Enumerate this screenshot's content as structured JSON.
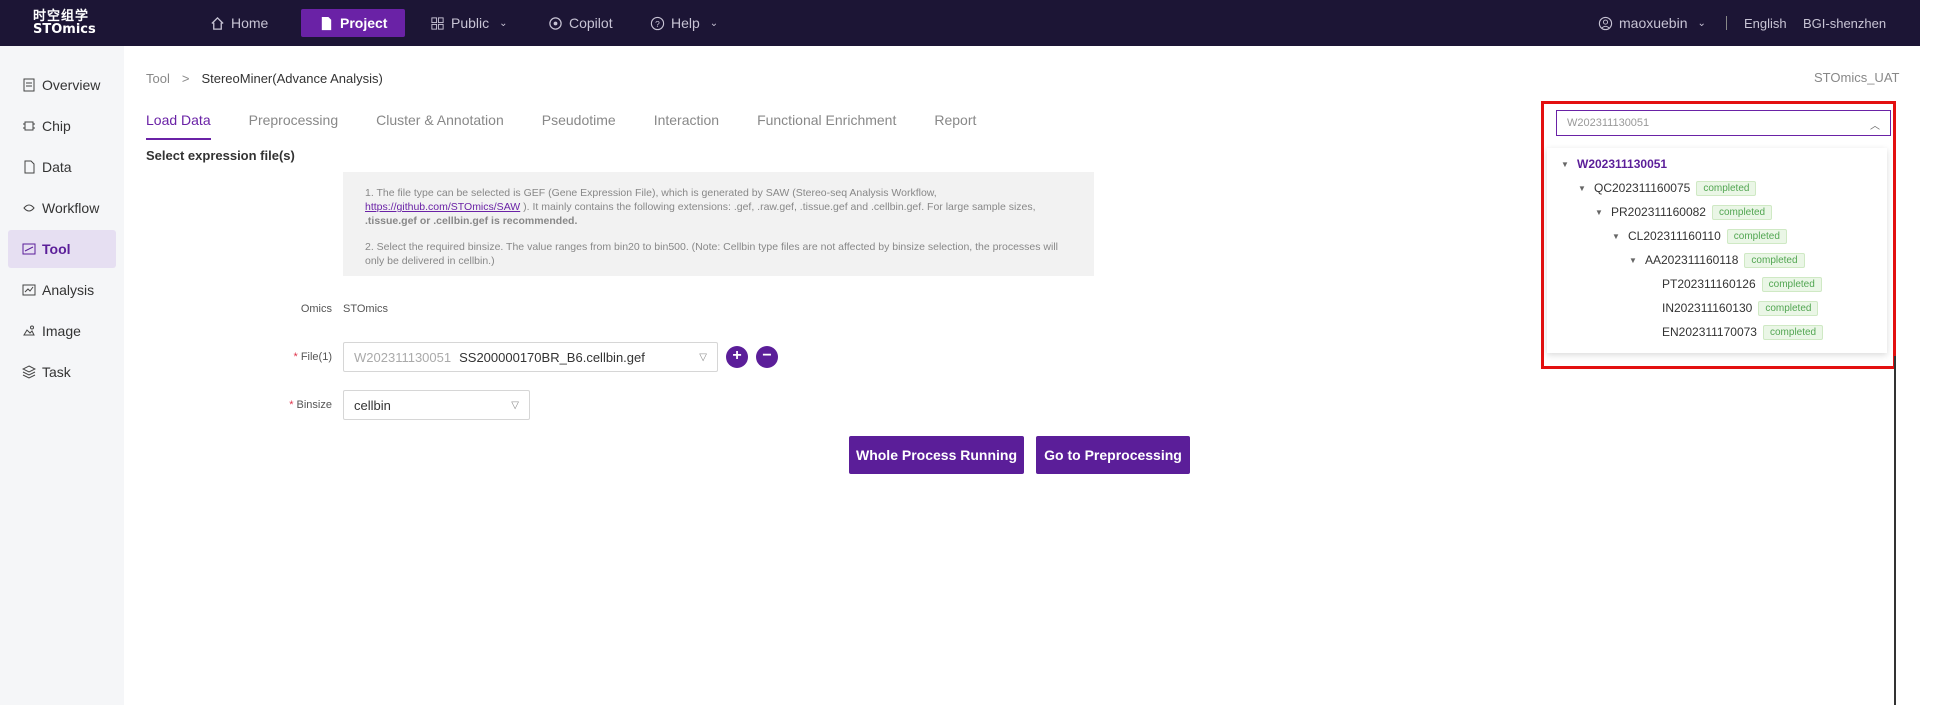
{
  "topbar": {
    "logo_cn": "时空组学",
    "logo_en": "STOmics",
    "nav": [
      {
        "label": "Home",
        "icon": "home-icon"
      },
      {
        "label": "Project",
        "icon": "document-icon"
      },
      {
        "label": "Public",
        "icon": "grid-icon"
      },
      {
        "label": "Copilot",
        "icon": "copilot-icon"
      },
      {
        "label": "Help",
        "icon": "help-icon"
      }
    ],
    "user": "maoxuebin",
    "language": "English",
    "region": "BGI-shenzhen"
  },
  "sidebar": {
    "items": [
      {
        "label": "Overview",
        "icon": "overview-icon"
      },
      {
        "label": "Chip",
        "icon": "chip-icon"
      },
      {
        "label": "Data",
        "icon": "data-icon"
      },
      {
        "label": "Workflow",
        "icon": "workflow-icon"
      },
      {
        "label": "Tool",
        "icon": "tool-icon"
      },
      {
        "label": "Analysis",
        "icon": "analysis-icon"
      },
      {
        "label": "Image",
        "icon": "image-icon"
      },
      {
        "label": "Task",
        "icon": "task-icon"
      }
    ]
  },
  "breadcrumb": {
    "root": "Tool",
    "separator": ">",
    "current": "StereoMiner(Advance Analysis)"
  },
  "environment": "STOmics_UAT",
  "tabs": [
    "Load Data",
    "Preprocessing",
    "Cluster & Annotation",
    "Pseudotime",
    "Interaction",
    "Functional Enrichment",
    "Report"
  ],
  "section_title": "Select expression file(s)",
  "notice": {
    "line1_a": "1. The file type can be selected is GEF (Gene Expression File), which is generated by SAW (Stereo-seq Analysis Workflow,",
    "link": "https://github.com/STOmics/SAW",
    "line1_b": "). It mainly contains the following extensions: .gef, .raw.gef, .tissue.gef and .cellbin.gef. For large sample sizes,",
    "line1_bold": ".tissue.gef or .cellbin.gef is recommended.",
    "line2": "2. Select the required binsize. The value ranges from bin20 to bin500. (Note: Cellbin type files are not affected by binsize selection, the processes will only be delivered in cellbin.)"
  },
  "form": {
    "omics_label": "Omics",
    "omics_value": "STOmics",
    "file_label": "File(1)",
    "file_prefix": "W202311130051",
    "file_value": "SS200000170BR_B6.cellbin.gef",
    "binsize_label": "Binsize",
    "binsize_value": "cellbin"
  },
  "buttons": {
    "run_all": "Whole Process Running",
    "next": "Go to Preprocessing"
  },
  "tree_select": {
    "placeholder": "W202311130051",
    "nodes": [
      {
        "label": "W202311130051",
        "status": ""
      },
      {
        "label": "QC202311160075",
        "status": "completed"
      },
      {
        "label": "PR202311160082",
        "status": "completed"
      },
      {
        "label": "CL202311160110",
        "status": "completed"
      },
      {
        "label": "AA202311160118",
        "status": "completed"
      },
      {
        "label": "PT202311160126",
        "status": "completed"
      },
      {
        "label": "IN202311160130",
        "status": "completed"
      },
      {
        "label": "EN202311170073",
        "status": "completed"
      }
    ]
  },
  "colors": {
    "primary": "#5b1e99",
    "topbar": "#1c1535",
    "highlight_box": "#e31010",
    "status_green": "#52a652"
  }
}
